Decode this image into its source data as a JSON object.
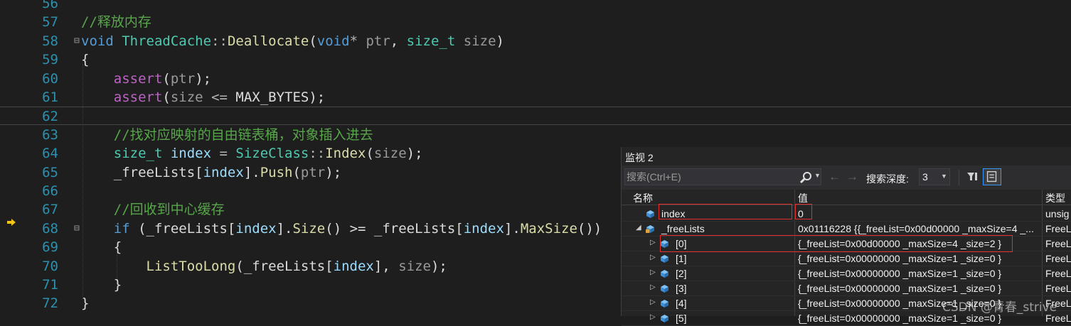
{
  "editor": {
    "lines": [
      {
        "num": "56",
        "tokens": []
      },
      {
        "num": "57",
        "tokens": [
          {
            "t": "//释放内存",
            "c": "comment"
          }
        ]
      },
      {
        "num": "58",
        "fold": "⊟",
        "tokens": [
          {
            "t": "void",
            "c": "kw"
          },
          {
            "t": " ",
            "c": "plain"
          },
          {
            "t": "ThreadCache",
            "c": "type"
          },
          {
            "t": "::",
            "c": "op"
          },
          {
            "t": "Deallocate",
            "c": "func"
          },
          {
            "t": "(",
            "c": "plain"
          },
          {
            "t": "void",
            "c": "kw"
          },
          {
            "t": "* ",
            "c": "op"
          },
          {
            "t": "ptr",
            "c": "param"
          },
          {
            "t": ", ",
            "c": "plain"
          },
          {
            "t": "size_t",
            "c": "type"
          },
          {
            "t": " ",
            "c": "plain"
          },
          {
            "t": "size",
            "c": "param"
          },
          {
            "t": ")",
            "c": "plain"
          }
        ]
      },
      {
        "num": "59",
        "tokens": [
          {
            "t": "{",
            "c": "plain"
          }
        ]
      },
      {
        "num": "60",
        "tokens": [
          {
            "t": "    ",
            "c": "plain"
          },
          {
            "t": "assert",
            "c": "macro"
          },
          {
            "t": "(",
            "c": "plain"
          },
          {
            "t": "ptr",
            "c": "param"
          },
          {
            "t": ");",
            "c": "plain"
          }
        ]
      },
      {
        "num": "61",
        "tokens": [
          {
            "t": "    ",
            "c": "plain"
          },
          {
            "t": "assert",
            "c": "macro"
          },
          {
            "t": "(",
            "c": "plain"
          },
          {
            "t": "size",
            "c": "param"
          },
          {
            "t": " <= ",
            "c": "op"
          },
          {
            "t": "MAX_BYTES",
            "c": "plain"
          },
          {
            "t": ");",
            "c": "plain"
          }
        ]
      },
      {
        "num": "62",
        "current": true,
        "tokens": []
      },
      {
        "num": "63",
        "tokens": [
          {
            "t": "    ",
            "c": "plain"
          },
          {
            "t": "//找对应映射的自由链表桶，对象插入进去",
            "c": "comment"
          }
        ]
      },
      {
        "num": "64",
        "tokens": [
          {
            "t": "    ",
            "c": "plain"
          },
          {
            "t": "size_t",
            "c": "type"
          },
          {
            "t": " ",
            "c": "plain"
          },
          {
            "t": "index",
            "c": "local"
          },
          {
            "t": " = ",
            "c": "op"
          },
          {
            "t": "SizeClass",
            "c": "type"
          },
          {
            "t": "::",
            "c": "op"
          },
          {
            "t": "Index",
            "c": "func"
          },
          {
            "t": "(",
            "c": "plain"
          },
          {
            "t": "size",
            "c": "param"
          },
          {
            "t": ");",
            "c": "plain"
          }
        ]
      },
      {
        "num": "65",
        "tokens": [
          {
            "t": "    ",
            "c": "plain"
          },
          {
            "t": "_freeLists",
            "c": "member"
          },
          {
            "t": "[",
            "c": "plain"
          },
          {
            "t": "index",
            "c": "local"
          },
          {
            "t": "].",
            "c": "plain"
          },
          {
            "t": "Push",
            "c": "func"
          },
          {
            "t": "(",
            "c": "plain"
          },
          {
            "t": "ptr",
            "c": "param"
          },
          {
            "t": ");",
            "c": "plain"
          }
        ]
      },
      {
        "num": "66",
        "tokens": []
      },
      {
        "num": "67",
        "tokens": [
          {
            "t": "    ",
            "c": "plain"
          },
          {
            "t": "//回收到中心缓存",
            "c": "comment"
          }
        ]
      },
      {
        "num": "68",
        "fold": "⊟",
        "tokens": [
          {
            "t": "    ",
            "c": "plain"
          },
          {
            "t": "if",
            "c": "kw"
          },
          {
            "t": " (",
            "c": "plain"
          },
          {
            "t": "_freeLists",
            "c": "member"
          },
          {
            "t": "[",
            "c": "plain"
          },
          {
            "t": "index",
            "c": "local"
          },
          {
            "t": "].",
            "c": "plain"
          },
          {
            "t": "Size",
            "c": "func"
          },
          {
            "t": "() >= ",
            "c": "plain"
          },
          {
            "t": "_freeLists",
            "c": "member"
          },
          {
            "t": "[",
            "c": "plain"
          },
          {
            "t": "index",
            "c": "local"
          },
          {
            "t": "].",
            "c": "plain"
          },
          {
            "t": "MaxSize",
            "c": "func"
          },
          {
            "t": "())",
            "c": "plain"
          }
        ]
      },
      {
        "num": "69",
        "tokens": [
          {
            "t": "    {",
            "c": "plain"
          }
        ]
      },
      {
        "num": "70",
        "tokens": [
          {
            "t": "        ",
            "c": "plain"
          },
          {
            "t": "ListTooLong",
            "c": "func"
          },
          {
            "t": "(",
            "c": "plain"
          },
          {
            "t": "_freeLists",
            "c": "member"
          },
          {
            "t": "[",
            "c": "plain"
          },
          {
            "t": "index",
            "c": "local"
          },
          {
            "t": "], ",
            "c": "plain"
          },
          {
            "t": "size",
            "c": "param"
          },
          {
            "t": ");",
            "c": "plain"
          }
        ]
      },
      {
        "num": "71",
        "tokens": [
          {
            "t": "    }",
            "c": "plain"
          }
        ]
      },
      {
        "num": "72",
        "tokens": [
          {
            "t": "}",
            "c": "plain"
          }
        ]
      }
    ]
  },
  "watch": {
    "title": "监视 2",
    "search_placeholder": "搜索(Ctrl+E)",
    "depth_label": "搜索深度:",
    "depth_value": "3",
    "columns": {
      "name": "名称",
      "value": "值",
      "type": "类型"
    },
    "rows": [
      {
        "name": "index",
        "value": "0",
        "type": "unsig",
        "level": 0,
        "expander": "",
        "icon": "field-icon",
        "highlight_name": true,
        "highlight_value": true
      },
      {
        "name": "_freeLists",
        "value": "0x01116228 {{_freeList=0x00d00000 _maxSize=4 _...",
        "type": "FreeL",
        "level": 0,
        "expander": "◢",
        "icon": "locked-field-icon"
      },
      {
        "name": "[0]",
        "value": "{_freeList=0x00d00000 _maxSize=4 _size=2 }",
        "type": "FreeL",
        "level": 1,
        "expander": "▷",
        "icon": "field-icon",
        "highlight_row": true
      },
      {
        "name": "[1]",
        "value": "{_freeList=0x00000000 _maxSize=1 _size=0 }",
        "type": "FreeL",
        "level": 1,
        "expander": "▷",
        "icon": "field-icon"
      },
      {
        "name": "[2]",
        "value": "{_freeList=0x00000000 _maxSize=1 _size=0 }",
        "type": "FreeL",
        "level": 1,
        "expander": "▷",
        "icon": "field-icon"
      },
      {
        "name": "[3]",
        "value": "{_freeList=0x00000000 _maxSize=1 _size=0 }",
        "type": "FreeL",
        "level": 1,
        "expander": "▷",
        "icon": "field-icon"
      },
      {
        "name": "[4]",
        "value": "{_freeList=0x00000000 _maxSize=1 _size=0 }",
        "type": "FreeL",
        "level": 1,
        "expander": "▷",
        "icon": "field-icon"
      },
      {
        "name": "[5]",
        "value": "{_freeList=0x00000000 _maxSize=1 _size=0 }",
        "type": "FreeL",
        "level": 1,
        "expander": "▷",
        "icon": "field-icon"
      }
    ]
  },
  "watermark": "CSDN @青春_strive",
  "colors": {
    "comment": "#57a64a",
    "keyword": "#569cd6",
    "type": "#4ec9b0",
    "function": "#dcdcaa",
    "macro": "#bd63c5",
    "line_number": "#2b91af",
    "highlight_box": "#e0302e"
  }
}
